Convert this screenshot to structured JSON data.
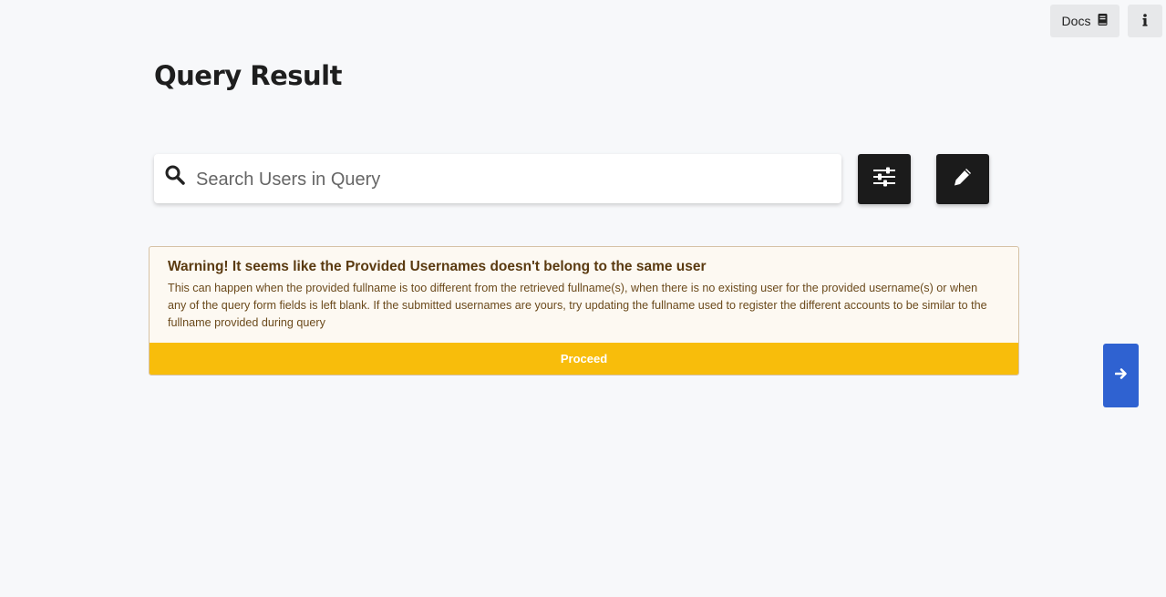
{
  "header": {
    "docs_label": "Docs",
    "docs_icon": "book-icon",
    "info_icon": "info-icon"
  },
  "page": {
    "title": "Query Result"
  },
  "search": {
    "placeholder": "Search Users in Query",
    "value": "",
    "icon": "search-icon"
  },
  "toolbar": {
    "filter_icon": "sliders-icon",
    "edit_icon": "pencil-icon"
  },
  "warning": {
    "title": "Warning! It seems like the Provided Usernames doesn't belong to the same user",
    "message": "This can happen when the provided fullname is too different from the retrieved fullname(s), when there is no existing user for the provided username(s) or when any of the query form fields is left blank. If the submitted usernames are yours, try updating the fullname used to register the different accounts to be similar to the fullname provided during query",
    "proceed_label": "Proceed"
  },
  "navigation": {
    "next_icon": "arrow-right-icon"
  },
  "colors": {
    "background": "#f7f8fa",
    "dark_button": "#1b1b1b",
    "warning_bg": "#fdf9f2",
    "warning_accent": "#f8bd0b",
    "next_button": "#2f62d1"
  }
}
